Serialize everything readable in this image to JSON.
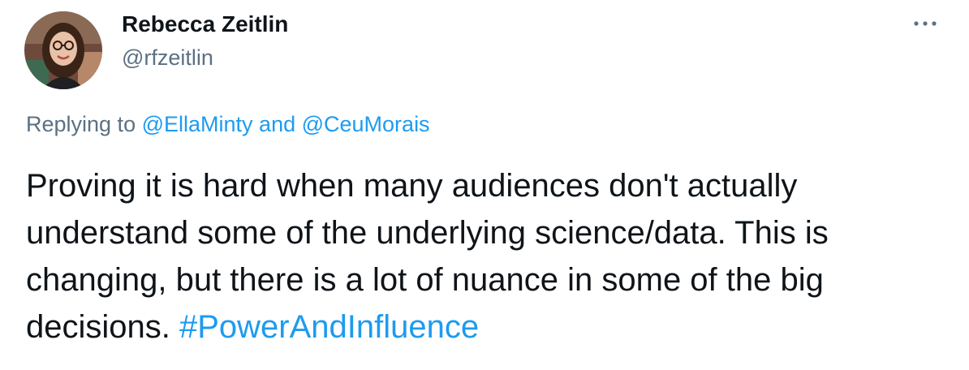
{
  "author": {
    "display_name": "Rebecca Zeitlin",
    "handle": "@rfzeitlin",
    "avatar_icon": "profile-photo"
  },
  "more_icon": "more-horizontal-icon",
  "reply_context": {
    "prefix": "Replying to ",
    "user1": "@EllaMinty",
    "joiner": " and ",
    "user2": "@CeuMorais"
  },
  "tweet": {
    "line1": "Proving it is hard when many audiences don't actually",
    "line2": "understand some of the underlying science/data. This is",
    "line3": "changing, but there is a lot of nuance in some of the big",
    "line4_text": "decisions. ",
    "hashtag": "#PowerAndInfluence"
  },
  "colors": {
    "link": "#1d9bf0",
    "secondary_text": "#5b7083",
    "primary_text": "#0f1419"
  }
}
